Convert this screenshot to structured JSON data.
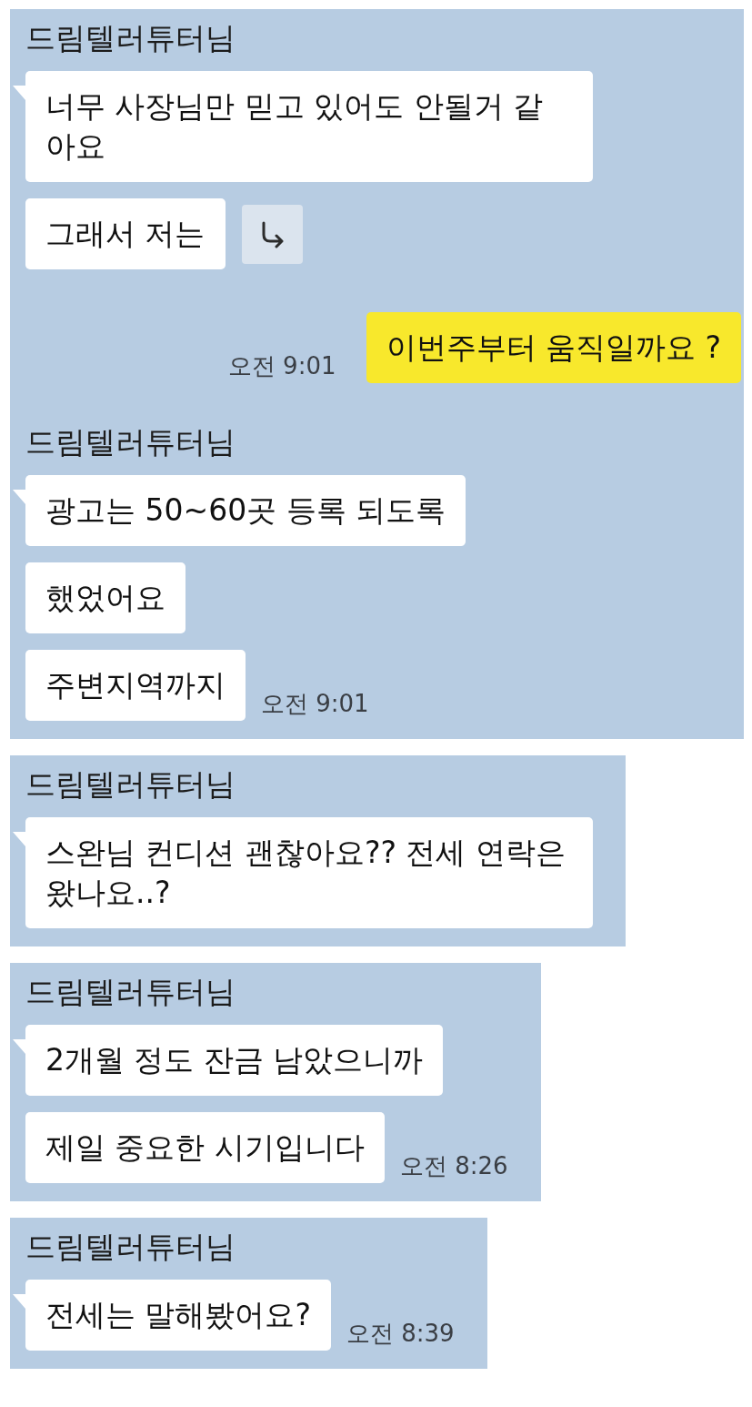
{
  "panels": [
    {
      "items": [
        {
          "kind": "received",
          "sender": "드림텔러튜터님",
          "messages": [
            {
              "text": "너무 사장님만 믿고 있어도 안될거 같아요"
            },
            {
              "text": "그래서 저는",
              "forward_button": true
            }
          ]
        },
        {
          "kind": "sent",
          "messages": [
            {
              "text": "이번주부터 움직일까요 ?"
            }
          ],
          "time": "오전 9:01"
        },
        {
          "kind": "received",
          "sender": "드림텔러튜터님",
          "messages": [
            {
              "text": "광고는 50~60곳 등록 되도록"
            },
            {
              "text": "했었어요"
            },
            {
              "text": "주변지역까지"
            }
          ],
          "time": "오전 9:01"
        }
      ]
    },
    {
      "items": [
        {
          "kind": "received",
          "sender": "드림텔러튜터님",
          "messages": [
            {
              "text": "스완님 컨디션 괜찮아요?? 전세 연락은 왔나요..?"
            }
          ]
        }
      ]
    },
    {
      "items": [
        {
          "kind": "received",
          "sender": "드림텔러튜터님",
          "messages": [
            {
              "text": "2개월 정도 잔금 남았으니까"
            },
            {
              "text": "제일 중요한 시기입니다"
            }
          ],
          "time": "오전 8:26"
        }
      ]
    },
    {
      "items": [
        {
          "kind": "received",
          "sender": "드림텔러튜터님",
          "messages": [
            {
              "text": "전세는 말해봤어요?"
            }
          ],
          "time": "오전 8:39"
        }
      ]
    }
  ]
}
